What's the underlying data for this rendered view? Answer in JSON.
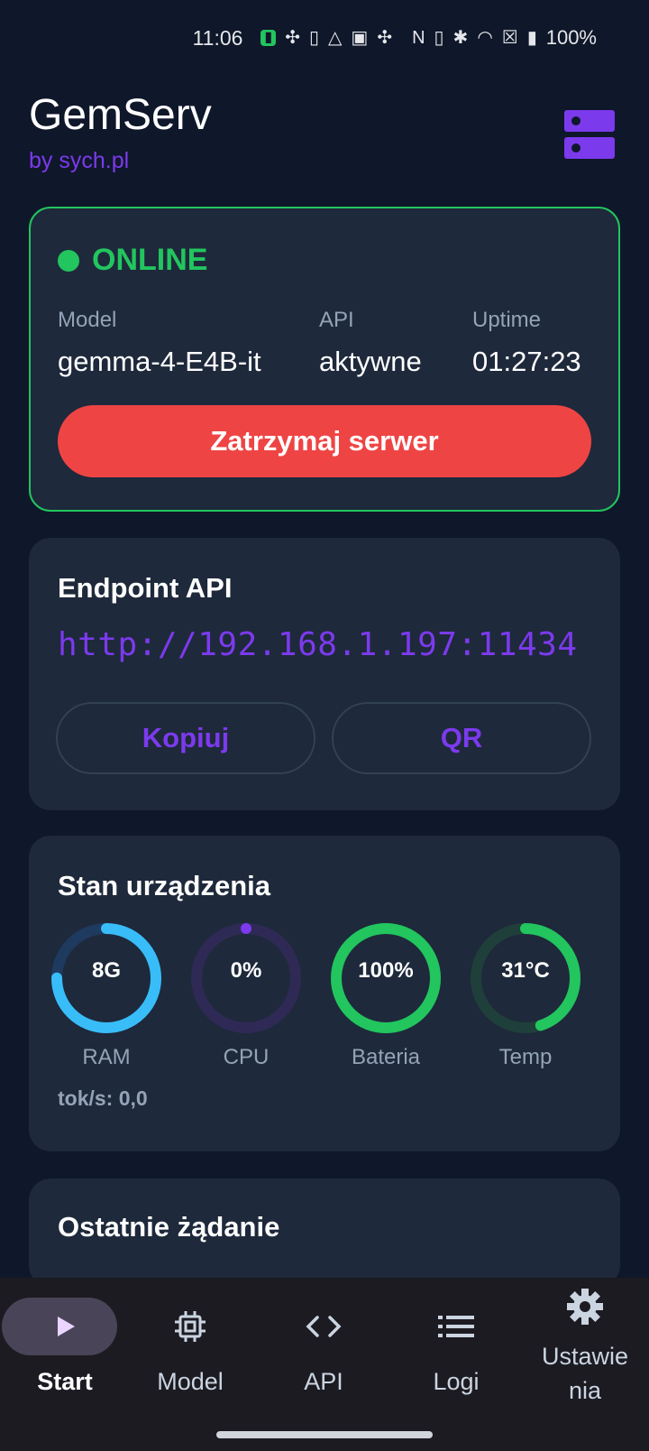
{
  "status_bar": {
    "time": "11:06",
    "battery": "100%",
    "icons": [
      "battery-saver-icon",
      "fan-icon",
      "phone-icon",
      "drive-icon",
      "linkedin-icon",
      "fan-icon",
      "nfc-icon",
      "vibrate-icon",
      "bluetooth-icon",
      "wifi-icon",
      "no-sim-icon",
      "battery-icon"
    ]
  },
  "header": {
    "title": "GemServ",
    "subtitle": "by sych.pl",
    "icon": "server-icon"
  },
  "status_card": {
    "state": "ONLINE",
    "model_label": "Model",
    "model_value": "gemma-4-E4B-it",
    "api_label": "API",
    "api_value": "aktywne",
    "uptime_label": "Uptime",
    "uptime_value": "01:27:23",
    "stop_button": "Zatrzymaj serwer"
  },
  "endpoint_card": {
    "title": "Endpoint API",
    "url": "http://192.168.1.197:11434",
    "copy_button": "Kopiuj",
    "qr_button": "QR"
  },
  "device_card": {
    "title": "Stan urządzenia",
    "gauges": [
      {
        "value_text": "8G",
        "label": "RAM",
        "fraction": 0.75,
        "color": "#38bdf8",
        "track": "#1e3a5f"
      },
      {
        "value_text": "0%",
        "label": "CPU",
        "fraction": 0.0,
        "color": "#7c3aed",
        "track": "#2e2a55"
      },
      {
        "value_text": "100%",
        "label": "Bateria",
        "fraction": 1.0,
        "color": "#22c55e",
        "track": "#14532d"
      },
      {
        "value_text": "31°C",
        "label": "Temp",
        "fraction": 0.45,
        "color": "#22c55e",
        "track": "#1f3f3a"
      }
    ],
    "toks": "tok/s: 0,0"
  },
  "last_request_card": {
    "title": "Ostatnie żądanie"
  },
  "bottom_nav": {
    "items": [
      {
        "label": "Start",
        "icon": "play-icon",
        "active": true
      },
      {
        "label": "Model",
        "icon": "chip-icon",
        "active": false
      },
      {
        "label": "API",
        "icon": "code-icon",
        "active": false
      },
      {
        "label": "Logi",
        "icon": "list-icon",
        "active": false
      },
      {
        "label": "Ustawie\nnia",
        "icon": "gear-icon",
        "active": false
      }
    ]
  },
  "colors": {
    "background": "#0f172a",
    "card": "#1e293b",
    "accent": "#7c3aed",
    "online": "#22c55e",
    "danger": "#ef4444"
  }
}
